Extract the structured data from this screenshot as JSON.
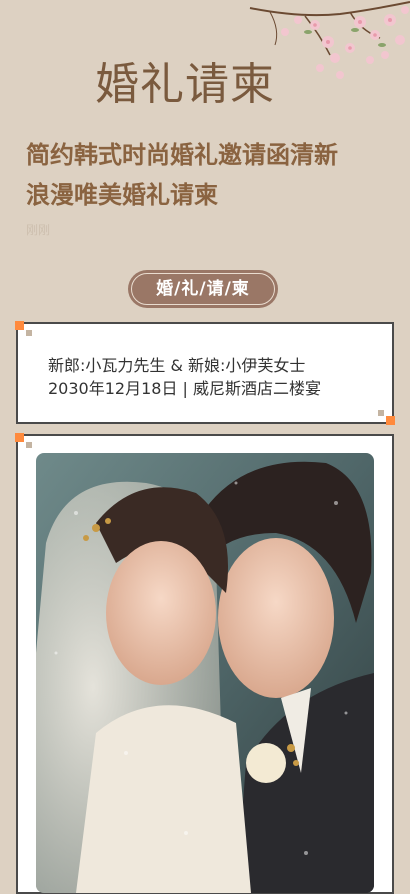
{
  "header": {
    "title": "婚礼请柬"
  },
  "article": {
    "title_line1": "简约韩式时尚婚礼邀请函清新",
    "title_line2": "浪漫唯美婚礼请柬",
    "author": "刚刚"
  },
  "badge": {
    "label": "婚/礼/请/柬"
  },
  "info": {
    "line1": "新郎:小瓦力先生 & 新娘:小伊芙女士",
    "line2": "2030年12月18日 | 威尼斯酒店二楼宴"
  },
  "colors": {
    "background": "#ddd1c2",
    "title": "#8a6340",
    "badge": "#9a7766",
    "accent": "#ff8a3d"
  },
  "icons": {
    "decoration": "cherry-blossom-branch",
    "photo": "bride-and-groom-photo"
  }
}
